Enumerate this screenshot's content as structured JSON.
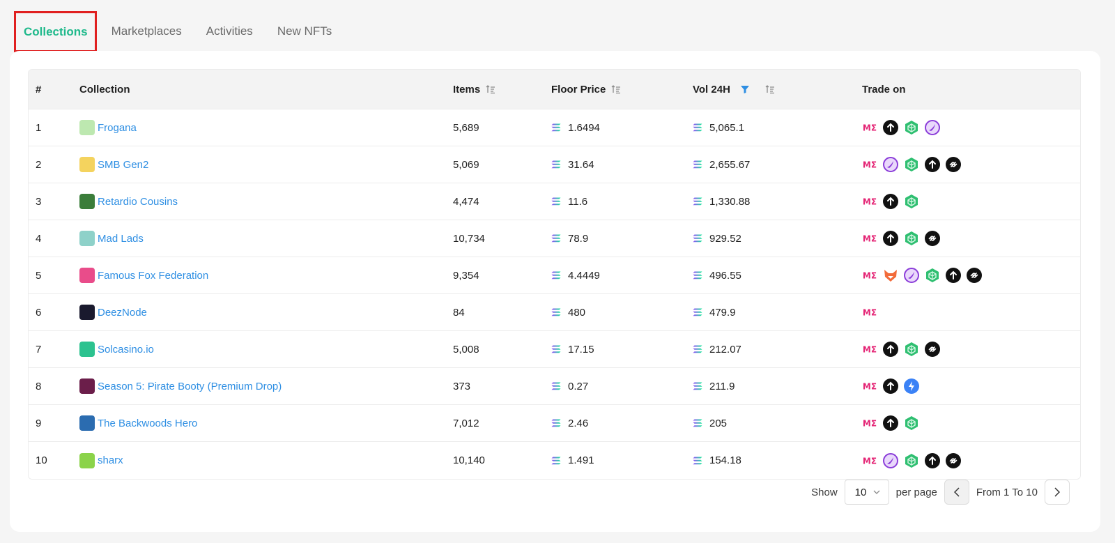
{
  "tabs": [
    {
      "label": "Collections",
      "active": true
    },
    {
      "label": "Marketplaces",
      "active": false
    },
    {
      "label": "Activities",
      "active": false
    },
    {
      "label": "New NFTs",
      "active": false
    }
  ],
  "table": {
    "headers": {
      "rank": "#",
      "collection": "Collection",
      "items": "Items",
      "floor": "Floor Price",
      "vol": "Vol 24H",
      "trade": "Trade on"
    },
    "rows": [
      {
        "rank": "1",
        "name": "Frogana",
        "items": "5,689",
        "floor": "1.6494",
        "vol": "5,065.1",
        "avatar": "#bde8b0",
        "markets": [
          "magic-eden",
          "tensor",
          "hyperspace",
          "solanart"
        ]
      },
      {
        "rank": "2",
        "name": "SMB Gen2",
        "items": "5,069",
        "floor": "31.64",
        "vol": "2,655.67",
        "avatar": "#f4d35e",
        "markets": [
          "magic-eden",
          "solanart",
          "hyperspace",
          "tensor",
          "sniper"
        ]
      },
      {
        "rank": "3",
        "name": "Retardio Cousins",
        "items": "4,474",
        "floor": "11.6",
        "vol": "1,330.88",
        "avatar": "#3b7d3a",
        "markets": [
          "magic-eden",
          "tensor",
          "hyperspace"
        ]
      },
      {
        "rank": "4",
        "name": "Mad Lads",
        "items": "10,734",
        "floor": "78.9",
        "vol": "929.52",
        "avatar": "#8ed1c9",
        "markets": [
          "magic-eden",
          "tensor",
          "hyperspace",
          "sniper"
        ]
      },
      {
        "rank": "5",
        "name": "Famous Fox Federation",
        "items": "9,354",
        "floor": "4.4449",
        "vol": "496.55",
        "avatar": "#e94c8a",
        "markets": [
          "magic-eden",
          "fox",
          "solanart",
          "hyperspace",
          "tensor",
          "sniper"
        ]
      },
      {
        "rank": "6",
        "name": "DeezNode",
        "items": "84",
        "floor": "480",
        "vol": "479.9",
        "avatar": "#1a1a2e",
        "markets": [
          "magic-eden"
        ]
      },
      {
        "rank": "7",
        "name": "Solcasino.io",
        "items": "5,008",
        "floor": "17.15",
        "vol": "212.07",
        "avatar": "#2cc28f",
        "markets": [
          "magic-eden",
          "tensor",
          "hyperspace",
          "sniper"
        ]
      },
      {
        "rank": "8",
        "name": "Season 5: Pirate Booty (Premium Drop)",
        "items": "373",
        "floor": "0.27",
        "vol": "211.9",
        "avatar": "#6b1e4a",
        "markets": [
          "magic-eden",
          "tensor",
          "coral"
        ]
      },
      {
        "rank": "9",
        "name": "The Backwoods Hero",
        "items": "7,012",
        "floor": "2.46",
        "vol": "205",
        "avatar": "#2b6cb0",
        "markets": [
          "magic-eden",
          "tensor",
          "hyperspace"
        ]
      },
      {
        "rank": "10",
        "name": "sharx",
        "items": "10,140",
        "floor": "1.491",
        "vol": "154.18",
        "avatar": "#8bd34a",
        "markets": [
          "magic-eden",
          "solanart",
          "hyperspace",
          "tensor",
          "sniper"
        ]
      }
    ]
  },
  "pagination": {
    "show_label": "Show",
    "per_page_value": "10",
    "per_page_label": "per page",
    "range": "From 1 To 10"
  },
  "colors": {
    "accent": "#1fb98b",
    "link": "#2f8fe3",
    "highlight": "#e02020",
    "magic_eden": "#e42575",
    "hyperspace": "#2fbf71",
    "solanart": "#8b3dd9"
  }
}
